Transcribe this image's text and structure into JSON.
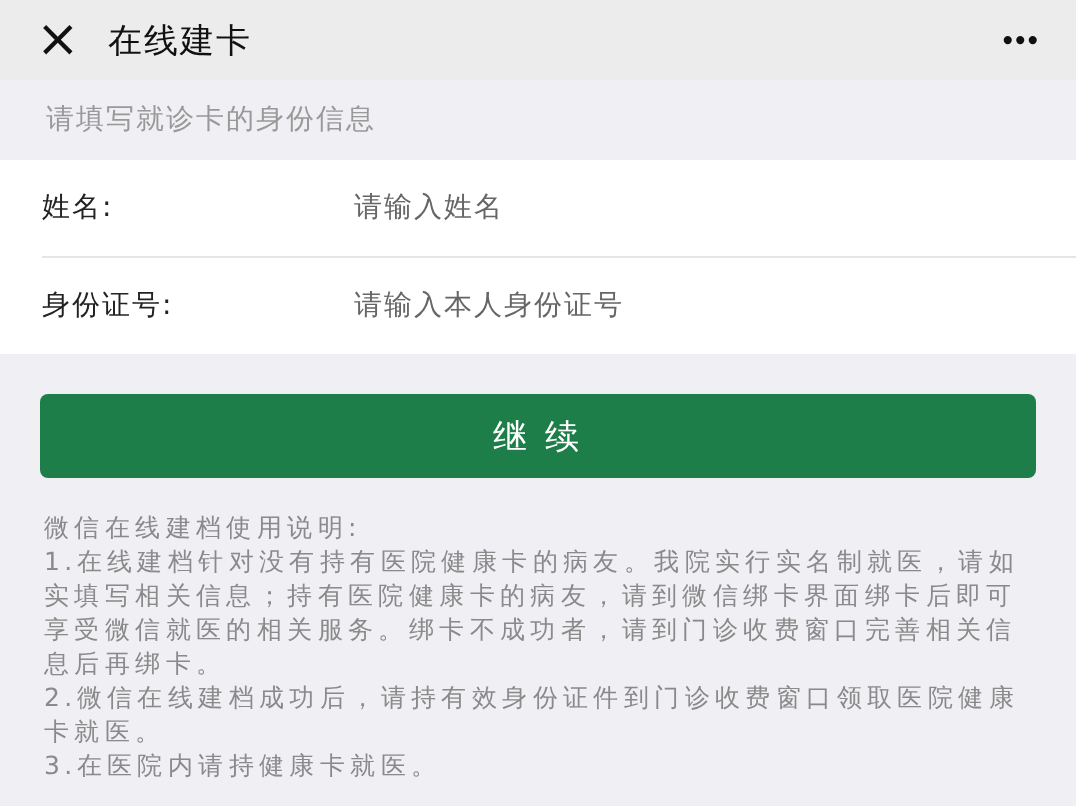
{
  "window": {
    "title": "在线建卡",
    "close": "×",
    "more": "•••"
  },
  "section_hint": "请填写就诊卡的身份信息",
  "fields": [
    {
      "label": "姓名:",
      "placeholder": "请输入姓名"
    },
    {
      "label": "身份证号:",
      "placeholder": "请输入本人身份证号"
    }
  ],
  "submit_button": "继 续",
  "notes": {
    "title": "微信在线建档使用说明:",
    "items": [
      "1.在线建档针对没有持有医院健康卡的病友。我院实行实名制就医，请如实填写相关信息；持有医院健康卡的病友，请到微信绑卡界面绑卡后即可享受微信就医的相关服务。绑卡不成功者，请到门诊收费窗口完善相关信息后再绑卡。",
      "2.微信在线建档成功后，请持有效身份证件到门诊收费窗口领取医院健康卡就医。",
      "3.在医院内请持健康卡就医。"
    ]
  }
}
